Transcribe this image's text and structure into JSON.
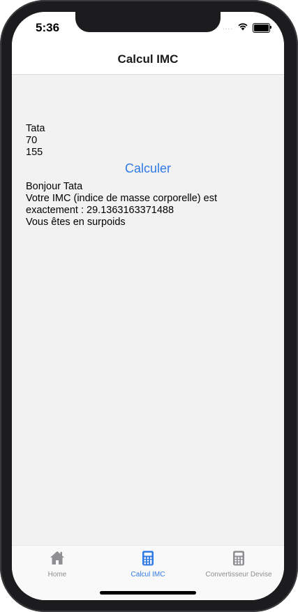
{
  "status_bar": {
    "time": "5:36",
    "signal_dots": "....",
    "wifi_icon": "wifi-icon",
    "battery_icon": "battery-icon"
  },
  "nav": {
    "title": "Calcul IMC"
  },
  "form": {
    "name_value": "Tata",
    "weight_value": "70",
    "height_value": "155",
    "calculate_label": "Calculer"
  },
  "result": {
    "greeting": "Bonjour Tata",
    "imc_line_1": "Votre IMC (indice de masse corporelle) est",
    "imc_line_2": "exactement : 29.1363163371488",
    "verdict": "Vous êtes en surpoids"
  },
  "tabs": [
    {
      "label": "Home",
      "icon": "home-icon",
      "active": false
    },
    {
      "label": "Calcul IMC",
      "icon": "calculator-icon",
      "active": true
    },
    {
      "label": "Convertisseur Devise",
      "icon": "calculator-icon",
      "active": false
    }
  ],
  "colors": {
    "accent": "#2f7ae5",
    "inactive": "#8e8e93",
    "background": "#f2f2f2"
  }
}
